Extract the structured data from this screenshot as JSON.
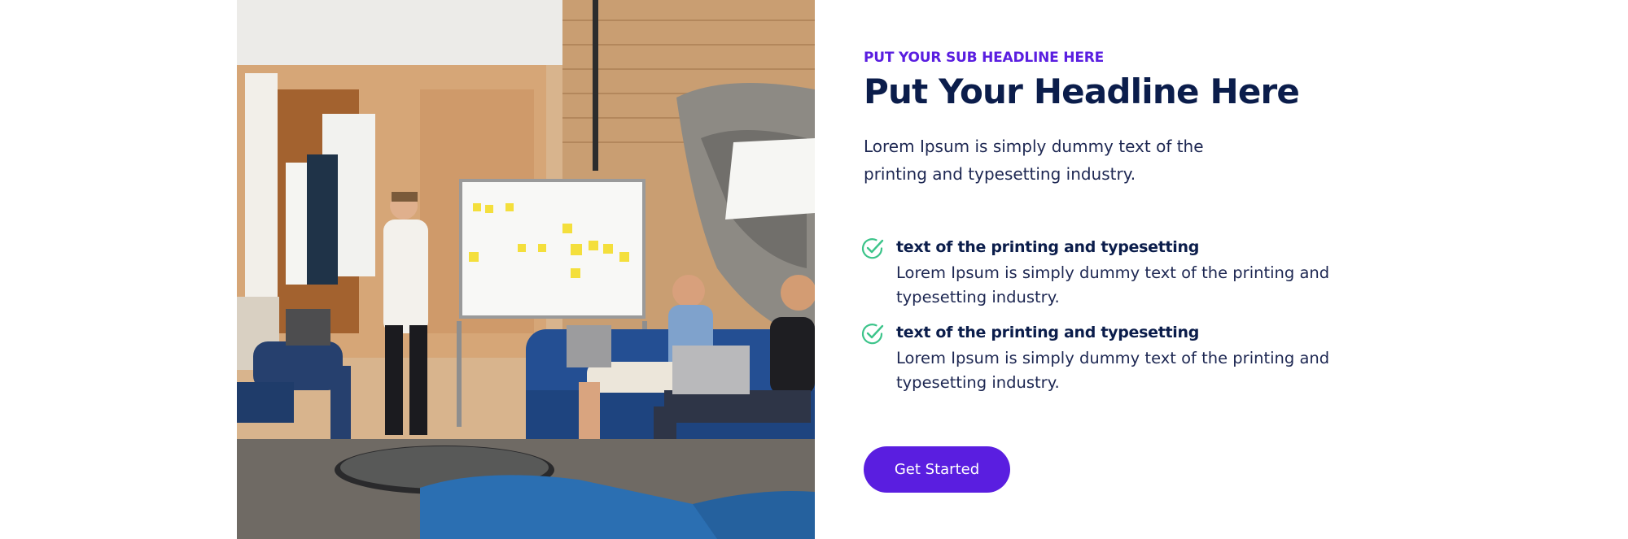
{
  "section": {
    "sub_headline": "PUT YOUR SUB HEADLINE HERE",
    "headline": "Put Your Headline Here",
    "intro": "Lorem Ipsum is simply dummy text of the printing and typesetting industry."
  },
  "features": [
    {
      "title": "text of the printing and typesetting",
      "text": "Lorem Ipsum is simply dummy text of the printing and typesetting industry."
    },
    {
      "title": "text of the printing and typesetting",
      "text": "Lorem Ipsum is simply dummy text of the printing and typesetting industry."
    }
  ],
  "cta": {
    "label": "Get Started"
  },
  "icons": {
    "feature_bullet": "check-circle-icon"
  },
  "colors": {
    "accent": "#5a1ee0",
    "headline": "#0b1d4b",
    "body_text": "#1d2752",
    "check": "#3cc48a"
  }
}
